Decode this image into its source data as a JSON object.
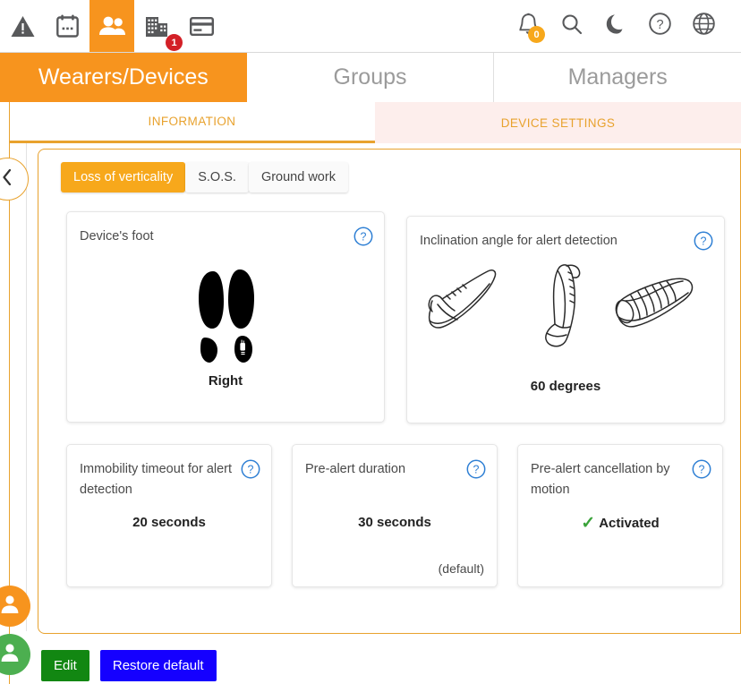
{
  "toolbar": {
    "left_icons": [
      {
        "name": "alert-triangle-icon",
        "label": "Alerts"
      },
      {
        "name": "calendar-icon",
        "label": "Calendar"
      },
      {
        "name": "people-icon",
        "label": "Wearers"
      },
      {
        "name": "building-icon",
        "label": "Sites",
        "badge": "1",
        "badge_color": "#d32027"
      },
      {
        "name": "card-icon",
        "label": "Billing"
      }
    ],
    "right_icons": [
      {
        "name": "bell-icon",
        "label": "Notifications",
        "badge": "0",
        "badge_color": "#f7a81b"
      },
      {
        "name": "search-icon",
        "label": "Search"
      },
      {
        "name": "moon-icon",
        "label": "Dark mode"
      },
      {
        "name": "help-circle-icon",
        "label": "Help"
      },
      {
        "name": "globe-icon",
        "label": "Language"
      }
    ],
    "accent_color": "#f7941e"
  },
  "nav_tabs": [
    {
      "label": "Wearers/Devices",
      "active": true
    },
    {
      "label": "Groups",
      "active": false
    },
    {
      "label": "Managers",
      "active": false
    }
  ],
  "sub_tabs": [
    {
      "label": "INFORMATION",
      "selected": true
    },
    {
      "label": "DEVICE SETTINGS",
      "selected": false
    }
  ],
  "rail": {
    "collapse_label": "‹",
    "avatars": [
      {
        "name": "wearer-avatar-orange",
        "color": "#f7941e"
      },
      {
        "name": "wearer-avatar-green",
        "color": "#4caf50"
      }
    ]
  },
  "mode_tabs": [
    {
      "label": "Loss of verticality",
      "active": true
    },
    {
      "label": "S.O.S.",
      "active": false
    },
    {
      "label": "Ground work",
      "active": false
    }
  ],
  "cards": {
    "device_foot": {
      "title": "Device's foot",
      "value": "Right",
      "help": "?"
    },
    "inclination": {
      "title": "Inclination angle for alert detection",
      "value": "60 degrees",
      "help": "?"
    },
    "immobility": {
      "title": "Immobility timeout for alert detection",
      "value": "20 seconds",
      "help": "?"
    },
    "prealert_duration": {
      "title": "Pre-alert duration",
      "value": "30 seconds",
      "note": "(default)",
      "help": "?"
    },
    "prealert_cancellation": {
      "title": "Pre-alert cancellation by motion",
      "value": "Activated",
      "check": "✓",
      "check_color": "#3aa33a",
      "help": "?"
    }
  },
  "buttons": {
    "edit": "Edit",
    "restore": "Restore default",
    "edit_color": "#128712",
    "restore_color": "#1500ff"
  }
}
